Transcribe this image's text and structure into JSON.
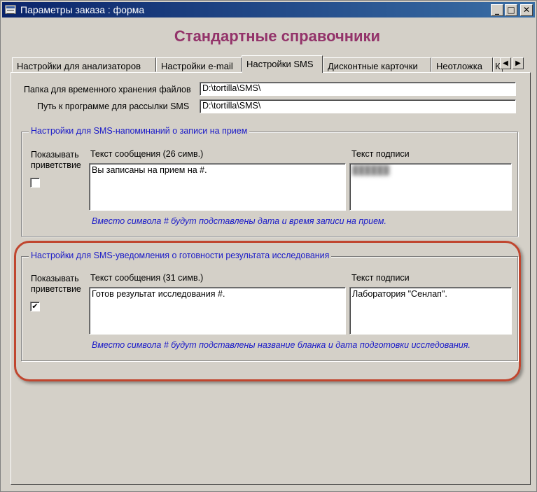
{
  "window": {
    "title": "Параметры заказа : форма",
    "minimize_glyph": "_",
    "maximize_glyph": "□",
    "close_glyph": "✕"
  },
  "heading": "Стандартные справочники",
  "tabs": [
    {
      "label": "Настройки для анализаторов",
      "active": false
    },
    {
      "label": "Настройки e-mail",
      "active": false
    },
    {
      "label": "Настройки SMS",
      "active": true
    },
    {
      "label": "Дисконтные карточки",
      "active": false
    },
    {
      "label": "Неотложка",
      "active": false
    },
    {
      "label": "К",
      "active": false
    }
  ],
  "tab_scroll": {
    "left": "◀",
    "right": "▶"
  },
  "fields": {
    "temp_folder": {
      "label": "Папка для временного хранения файлов",
      "value": "D:\\tortilla\\SMS\\"
    },
    "sms_program": {
      "label": "Путь к программе для рассылки SMS",
      "value": "D:\\tortilla\\SMS\\"
    }
  },
  "group_reminder": {
    "title": "Настройки для SMS-напоминаний о записи на прием",
    "show_greeting_label": "Показывать приветствие",
    "show_greeting_checked": false,
    "message_label": "Текст сообщения (26 симв.)",
    "message_value": "Вы записаны на прием на #.",
    "signature_label": "Текст подписи",
    "signature_value": "██████",
    "hint": "Вместо символа # будут подставлены дата и время записи на прием."
  },
  "group_result": {
    "title": "Настройки для SMS-уведомления о готовности результата исследования",
    "show_greeting_label": "Показывать приветствие",
    "show_greeting_checked": true,
    "check_glyph": "✔",
    "message_label": "Текст сообщения (31 симв.)",
    "message_value": "Готов результат исследования #.",
    "signature_label": "Текст подписи",
    "signature_value": "Лаборатория \"Сенлап\".",
    "hint": "Вместо символа # будут подставлены название бланка и дата подготовки исследования."
  },
  "colors": {
    "heading": "#93336a",
    "group_title": "#1a1ac8",
    "highlight": "#c0462f",
    "face": "#d4d0c8"
  }
}
